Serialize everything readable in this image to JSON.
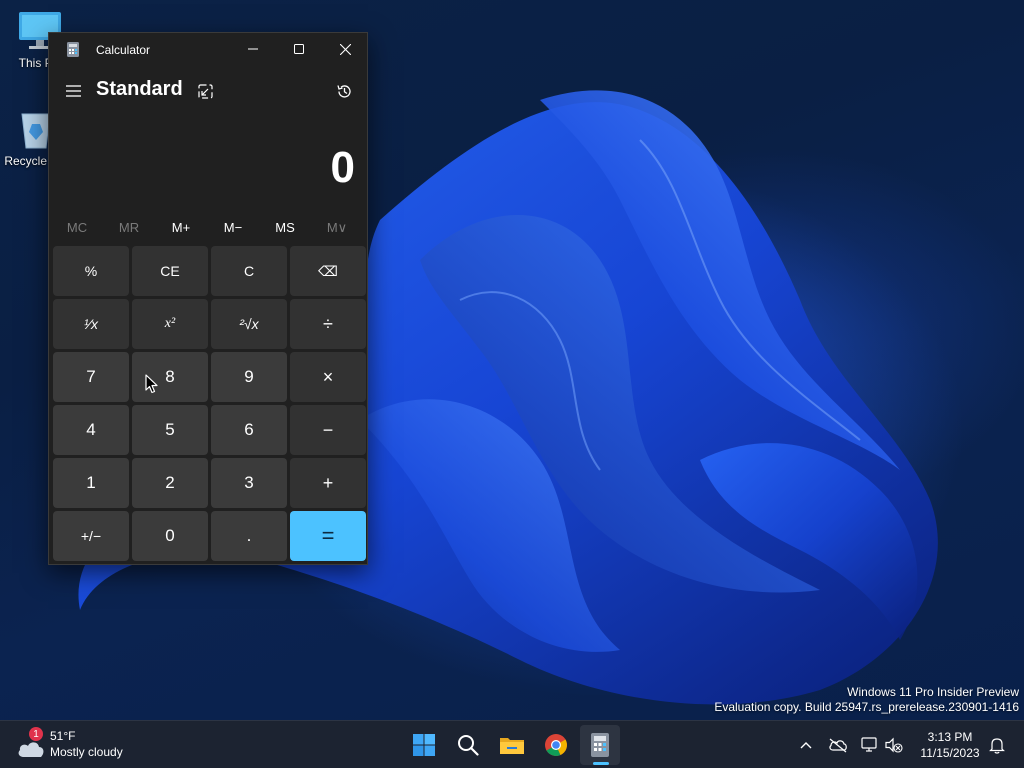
{
  "desktop": {
    "icons": [
      {
        "label": "This PC"
      },
      {
        "label": "Recycle Bin"
      }
    ],
    "watermark": {
      "line1": "Windows 11 Pro Insider Preview",
      "line2": "Evaluation copy. Build 25947.rs_prerelease.230901-1416"
    }
  },
  "calculator": {
    "title": "Calculator",
    "mode": "Standard",
    "display": "0",
    "memory": [
      {
        "label": "MC",
        "enabled": false
      },
      {
        "label": "MR",
        "enabled": false
      },
      {
        "label": "M+",
        "enabled": true
      },
      {
        "label": "M−",
        "enabled": true
      },
      {
        "label": "MS",
        "enabled": true
      },
      {
        "label": "M∨",
        "enabled": false
      }
    ],
    "keys": [
      [
        "%",
        "CE",
        "C",
        "⌫"
      ],
      [
        "¹⁄x",
        "x²",
        "²√x",
        "÷"
      ],
      [
        "7",
        "8",
        "9",
        "×"
      ],
      [
        "4",
        "5",
        "6",
        "−"
      ],
      [
        "1",
        "2",
        "3",
        "+"
      ],
      [
        "+/−",
        "0",
        ".",
        "="
      ]
    ]
  },
  "taskbar": {
    "weather": {
      "temp": "51°F",
      "condition": "Mostly cloudy",
      "badge": "1"
    },
    "clock": {
      "time": "3:13 PM",
      "date": "11/15/2023"
    }
  },
  "colors": {
    "accent": "#4cc2ff",
    "window_bg": "#202020",
    "key_bg": "#3b3b3b",
    "fn_key_bg": "#323232"
  }
}
